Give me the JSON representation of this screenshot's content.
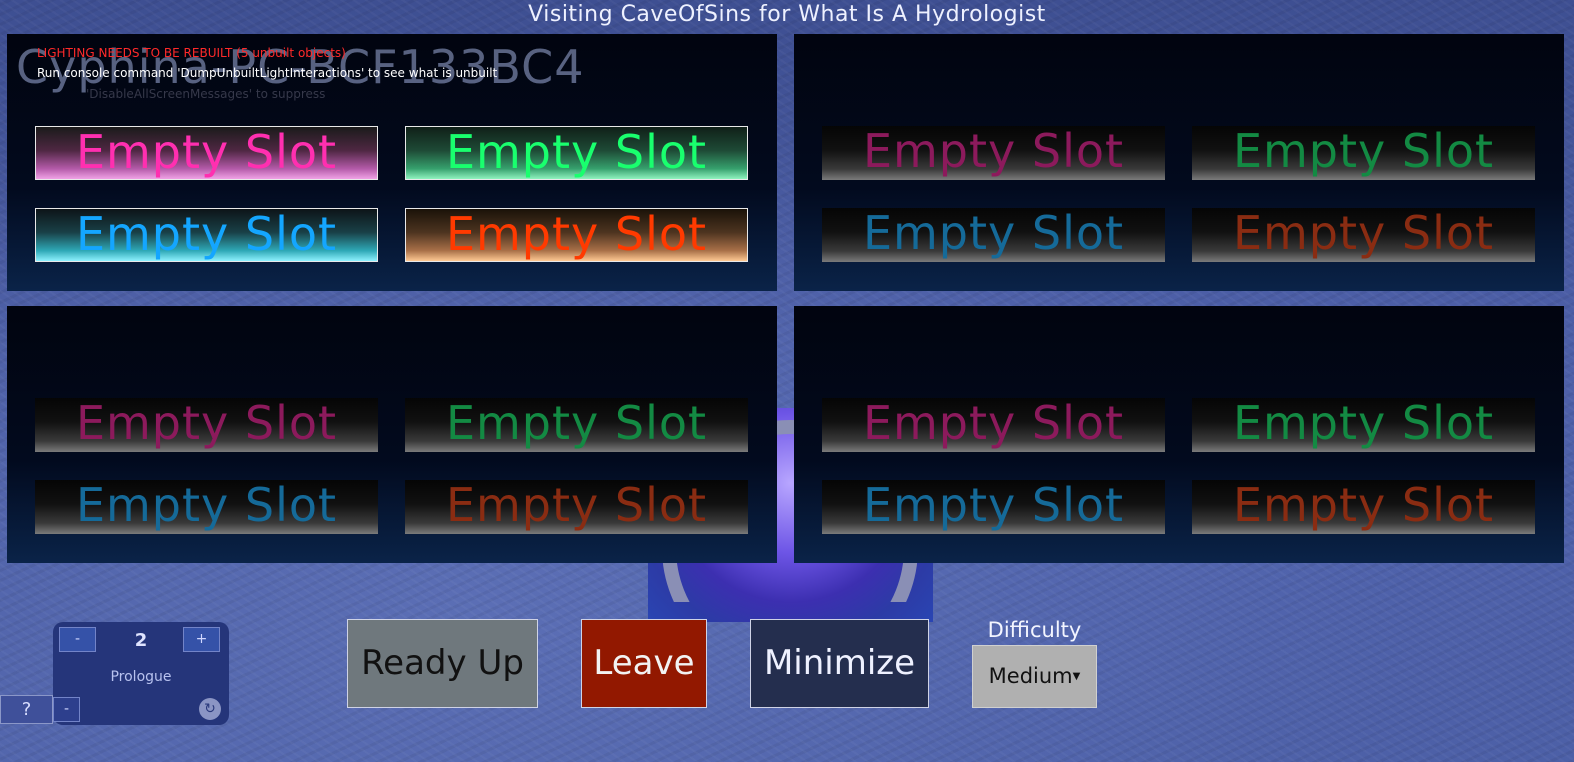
{
  "header": {
    "title": "Visiting CaveOfSins for What Is A Hydrologist"
  },
  "overlay": {
    "player_name": "Cyphina-PC-BCF133BC4",
    "log_warning": "LIGHTING NEEDS TO BE REBUILT (5 unbuilt objects)",
    "log_hint": "Run console command 'DumpUnbuiltLightInteractions' to see what is unbuilt",
    "log_faded": "'DisableAllScreenMessages' to suppress"
  },
  "slots": {
    "empty_label": "Empty Slot"
  },
  "colors": {
    "pink": "#ff2fb0",
    "green": "#19ff6e",
    "blue": "#14a6ff",
    "orange": "#ff3a00"
  },
  "party_widget": {
    "minus_label": "-",
    "plus_label": "+",
    "count": "2",
    "chapter": "Prologue",
    "small_minus": "-",
    "refresh_icon": "refresh-icon"
  },
  "help": {
    "label": "?"
  },
  "actions": {
    "ready_up": "Ready Up",
    "leave": "Leave",
    "minimize": "Minimize"
  },
  "difficulty": {
    "label": "Difficulty",
    "selected": "Medium"
  }
}
